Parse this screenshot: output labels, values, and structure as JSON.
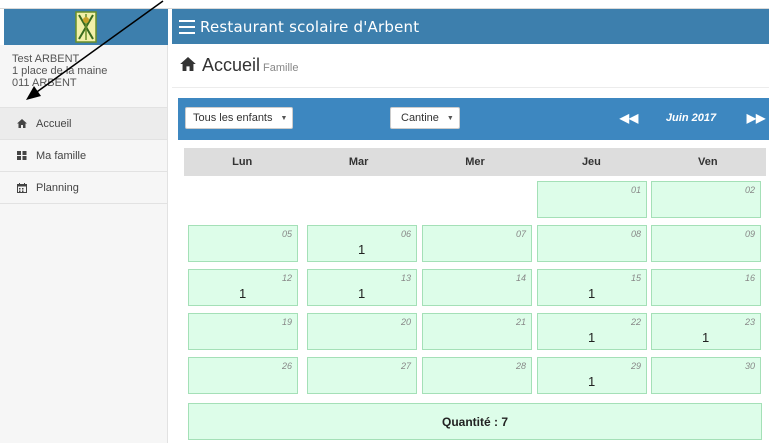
{
  "header": {
    "title": "Restaurant scolaire d'Arbent"
  },
  "user": {
    "name": "Test ARBENT",
    "address": "1 place de la maine",
    "city": "011 ARBENT"
  },
  "sidebar": {
    "items": [
      {
        "label": "Accueil",
        "icon": "home-icon"
      },
      {
        "label": "Ma famille",
        "icon": "family-icon"
      },
      {
        "label": "Planning",
        "icon": "calendar-icon"
      }
    ]
  },
  "page": {
    "title": "Accueil",
    "subtitle": "Famille"
  },
  "toolbar": {
    "children_select": "Tous les enfants",
    "service_select": "Cantine",
    "month": "Juin 2017",
    "prev_icon": "double-chevron-left-icon",
    "next_icon": "double-chevron-right-icon"
  },
  "calendar": {
    "days": [
      "Lun",
      "Mar",
      "Mer",
      "Jeu",
      "Ven"
    ],
    "weeks": [
      [
        {
          "d": "",
          "q": ""
        },
        {
          "d": "",
          "q": ""
        },
        {
          "d": "",
          "q": ""
        },
        {
          "d": "01",
          "q": ""
        },
        {
          "d": "02",
          "q": ""
        }
      ],
      [
        {
          "d": "05",
          "q": ""
        },
        {
          "d": "06",
          "q": "1"
        },
        {
          "d": "07",
          "q": ""
        },
        {
          "d": "08",
          "q": ""
        },
        {
          "d": "09",
          "q": ""
        }
      ],
      [
        {
          "d": "12",
          "q": "1"
        },
        {
          "d": "13",
          "q": "1"
        },
        {
          "d": "14",
          "q": ""
        },
        {
          "d": "15",
          "q": "1"
        },
        {
          "d": "16",
          "q": ""
        }
      ],
      [
        {
          "d": "19",
          "q": ""
        },
        {
          "d": "20",
          "q": ""
        },
        {
          "d": "21",
          "q": ""
        },
        {
          "d": "22",
          "q": "1"
        },
        {
          "d": "23",
          "q": "1"
        }
      ],
      [
        {
          "d": "26",
          "q": ""
        },
        {
          "d": "27",
          "q": ""
        },
        {
          "d": "28",
          "q": ""
        },
        {
          "d": "29",
          "q": "1"
        },
        {
          "d": "30",
          "q": ""
        }
      ]
    ],
    "total": "Quantité : 7"
  },
  "colors": {
    "header": "#3d7fad",
    "toolbar": "#3d87c0",
    "cell": "#ddfde9",
    "cell_border": "#a4e0b7"
  }
}
